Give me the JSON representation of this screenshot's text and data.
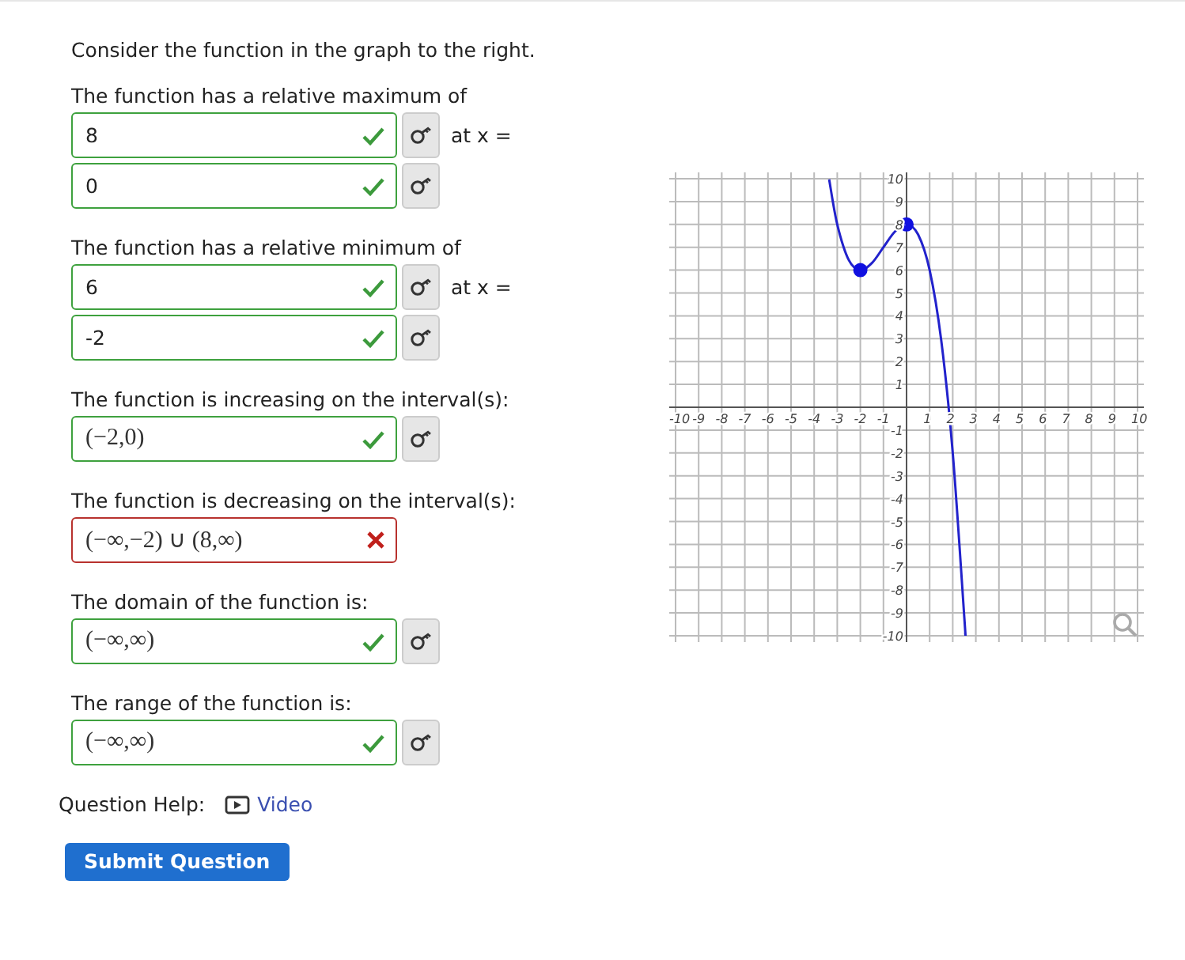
{
  "intro": "Consider the function in the graph to the right.",
  "questions": [
    {
      "label": "The function has a relative maximum of",
      "fields": [
        {
          "kind": "plain",
          "value": "8",
          "correct": true,
          "key_button": true,
          "suffix": "at x ="
        },
        {
          "kind": "plain",
          "value": "0",
          "correct": true,
          "key_button": true
        }
      ]
    },
    {
      "label": "The function has a relative minimum of",
      "fields": [
        {
          "kind": "plain",
          "value": "6",
          "correct": true,
          "key_button": true,
          "suffix": "at x ="
        },
        {
          "kind": "plain",
          "value": "-2",
          "correct": true,
          "key_button": true
        }
      ]
    },
    {
      "label": "The function is increasing on the interval(s):",
      "fields": [
        {
          "kind": "math",
          "value": "(−2,0)",
          "correct": true,
          "key_button": true
        }
      ]
    },
    {
      "label": "The function is decreasing on the interval(s):",
      "fields": [
        {
          "kind": "math",
          "value": "(−∞,−2) ∪ (8,∞)",
          "correct": false
        }
      ]
    },
    {
      "label": "The domain of the function is:",
      "fields": [
        {
          "kind": "math",
          "value": "(−∞,∞)",
          "correct": true,
          "key_button": true
        }
      ]
    },
    {
      "label": "The range of the function is:",
      "fields": [
        {
          "kind": "math",
          "value": "(−∞,∞)",
          "correct": true,
          "key_button": true
        }
      ]
    }
  ],
  "help": {
    "label": "Question Help:",
    "link": "Video"
  },
  "submit": "Submit Question",
  "graph": {
    "chart_data": {
      "type": "line",
      "grid": true,
      "x": [
        -3.35,
        -3,
        -2.5,
        -2,
        -1.5,
        -1,
        -0.5,
        0,
        0.5,
        1,
        1.5,
        2,
        2.5,
        2.54
      ],
      "series": [
        {
          "color": "#2222cc",
          "values": [
            9.97,
            8,
            6.44,
            6,
            6.31,
            7,
            7.69,
            8,
            7.56,
            6,
            2.94,
            -2,
            -9.19,
            -9.9
          ]
        }
      ],
      "xlim": [
        -10,
        10
      ],
      "ylim": [
        -10,
        10
      ],
      "xticks": [
        -10,
        -9,
        -8,
        -7,
        -6,
        -5,
        -4,
        -3,
        -2,
        -1,
        1,
        2,
        3,
        4,
        5,
        6,
        7,
        8,
        9,
        10
      ],
      "yticks": [
        -10,
        -9,
        -8,
        -7,
        -6,
        -5,
        -4,
        -3,
        -2,
        -1,
        1,
        2,
        3,
        4,
        5,
        6,
        7,
        8,
        9,
        10
      ]
    }
  }
}
